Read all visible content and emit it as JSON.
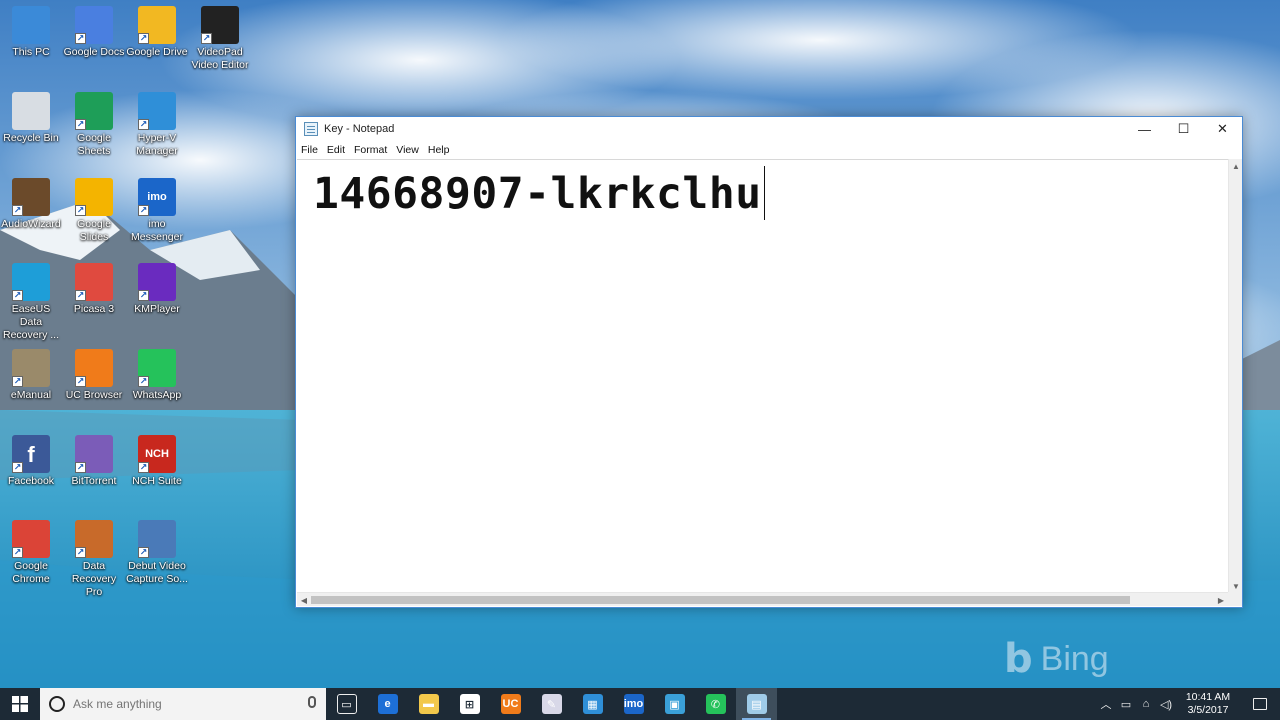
{
  "desktop": {
    "icons": [
      {
        "label": "This PC",
        "icon": "computer-icon",
        "color": "#3b8ad8"
      },
      {
        "label": "Google Docs",
        "icon": "document-icon",
        "color": "#4a7fe0"
      },
      {
        "label": "Google Drive",
        "icon": "drive-icon",
        "color": "#f2b822"
      },
      {
        "label": "VideoPad Video Editor",
        "icon": "star-icon",
        "color": "#222222"
      },
      {
        "label": "Recycle Bin",
        "icon": "recycle-bin-icon",
        "color": "#d8dde3"
      },
      {
        "label": "Google Sheets",
        "icon": "spreadsheet-icon",
        "color": "#1e9e58"
      },
      {
        "label": "Hyper-V Manager",
        "icon": "server-icon",
        "color": "#2f8fd8"
      },
      {
        "label": "AudioWizard",
        "icon": "speaker-icon",
        "color": "#6b4a2a"
      },
      {
        "label": "Google Slides",
        "icon": "slides-icon",
        "color": "#f4b400"
      },
      {
        "label": "imo Messenger",
        "icon": "chat-icon",
        "color": "#1b66c9",
        "glyph": "imo"
      },
      {
        "label": "EaseUS Data Recovery ...",
        "icon": "recovery-icon",
        "color": "#1e9ed8"
      },
      {
        "label": "Picasa 3",
        "icon": "camera-aperture-icon",
        "color": "#e04a3f"
      },
      {
        "label": "KMPlayer",
        "icon": "play-icon",
        "color": "#6a2bbf"
      },
      {
        "label": "eManual",
        "icon": "manual-icon",
        "color": "#9a8a6a"
      },
      {
        "label": "UC Browser",
        "icon": "browser-icon",
        "color": "#f07b1a"
      },
      {
        "label": "WhatsApp",
        "icon": "phone-icon",
        "color": "#25c25b"
      },
      {
        "label": "Facebook",
        "icon": "facebook-icon",
        "color": "#3b5998",
        "glyph": "f"
      },
      {
        "label": "BitTorrent",
        "icon": "torrent-icon",
        "color": "#7b5cb8"
      },
      {
        "label": "NCH Suite",
        "icon": "suite-icon",
        "color": "#c8281e",
        "glyph": "NCH"
      },
      {
        "label": "Google Chrome",
        "icon": "chrome-icon",
        "color": "#db4437"
      },
      {
        "label": "Data Recovery Pro",
        "icon": "data-recovery-icon",
        "color": "#c86a2a"
      },
      {
        "label": "Debut Video Capture So...",
        "icon": "film-icon",
        "color": "#4a7ab8"
      }
    ]
  },
  "notepad": {
    "title": "Key - Notepad",
    "menu": [
      "File",
      "Edit",
      "Format",
      "View",
      "Help"
    ],
    "content": "14668907-lkrkclhu",
    "controls": {
      "minimize": "—",
      "maximize": "☐",
      "close": "✕"
    }
  },
  "watermark": {
    "text": "Bing"
  },
  "taskbar": {
    "search_placeholder": "Ask me anything",
    "apps": [
      {
        "name": "task-view",
        "icon": "task-view-icon",
        "color": "#1d2a36",
        "glyph": "▭"
      },
      {
        "name": "edge",
        "icon": "edge-icon",
        "color": "#1d6fd6",
        "glyph": "e"
      },
      {
        "name": "file-explorer",
        "icon": "folder-icon",
        "color": "#f2c84b",
        "glyph": "▬"
      },
      {
        "name": "store",
        "icon": "store-icon",
        "color": "#ffffff",
        "glyph": "⊞"
      },
      {
        "name": "uc-browser",
        "icon": "browser-icon",
        "color": "#f07b1a",
        "glyph": "UC"
      },
      {
        "name": "paint",
        "icon": "paint-icon",
        "color": "#d8d8e8",
        "glyph": "✎"
      },
      {
        "name": "hyper-v",
        "icon": "server-icon",
        "color": "#2f8fd8",
        "glyph": "▦"
      },
      {
        "name": "imo",
        "icon": "chat-icon",
        "color": "#1b66c9",
        "glyph": "imo"
      },
      {
        "name": "network-app",
        "icon": "monitor-icon",
        "color": "#3aa0d8",
        "glyph": "▣"
      },
      {
        "name": "whatsapp",
        "icon": "phone-icon",
        "color": "#25c25b",
        "glyph": "✆"
      },
      {
        "name": "notepad",
        "icon": "notepad-icon",
        "color": "#9fcbe8",
        "glyph": "▤"
      }
    ],
    "clock": {
      "time": "10:41 AM",
      "date": "3/5/2017"
    }
  }
}
